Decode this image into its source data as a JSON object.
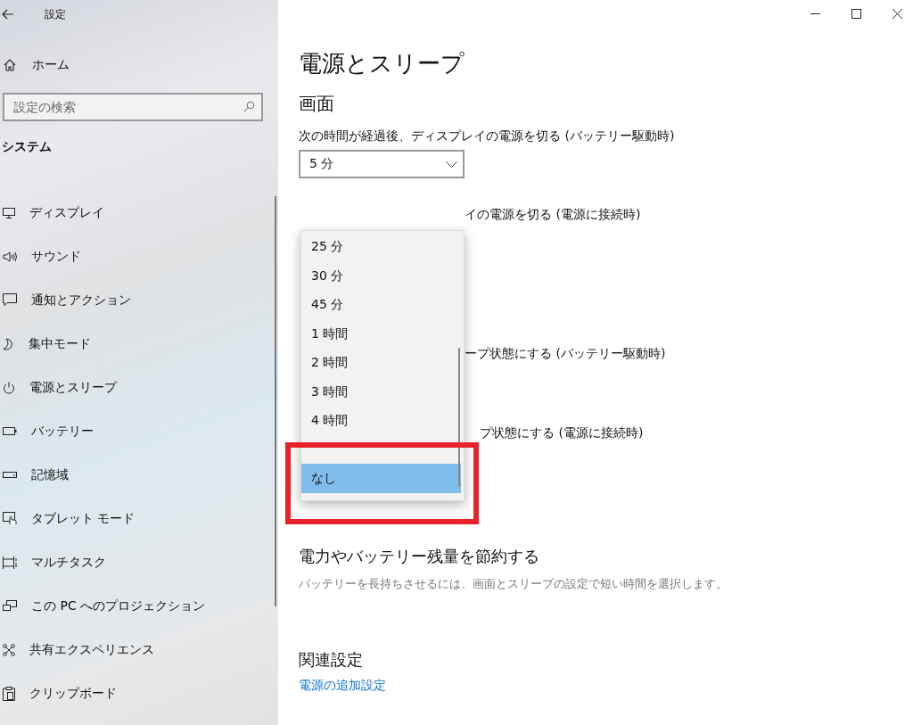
{
  "window": {
    "title": "設定"
  },
  "sidebar": {
    "home": "ホーム",
    "search": {
      "placeholder": "設定の検索"
    },
    "section": "システム",
    "items": [
      {
        "label": "ディスプレイ"
      },
      {
        "label": "サウンド"
      },
      {
        "label": "通知とアクション"
      },
      {
        "label": "集中モード"
      },
      {
        "label": "電源とスリープ"
      },
      {
        "label": "バッテリー"
      },
      {
        "label": "記憶域"
      },
      {
        "label": "タブレット モード"
      },
      {
        "label": "マルチタスク"
      },
      {
        "label": "この PC へのプロジェクション"
      },
      {
        "label": "共有エクスペリエンス"
      },
      {
        "label": "クリップボード"
      }
    ]
  },
  "main": {
    "title": "電源とスリープ",
    "section": "画面",
    "settings": [
      {
        "label": "次の時間が経過後、ディスプレイの電源を切る (バッテリー駆動時)",
        "value": "5 分"
      },
      {
        "label": "イの電源を切る (電源に接続時)"
      },
      {
        "label": "ープ状態にする (バッテリー駆動時)"
      },
      {
        "label": "プ状態にする (電源に接続時)"
      }
    ],
    "dropdown": {
      "options": [
        {
          "label": "25 分",
          "selected": false
        },
        {
          "label": "30 分",
          "selected": false
        },
        {
          "label": "45 分",
          "selected": false
        },
        {
          "label": "1 時間",
          "selected": false
        },
        {
          "label": "2 時間",
          "selected": false
        },
        {
          "label": "3 時間",
          "selected": false
        },
        {
          "label": "4 時間",
          "selected": false
        },
        {
          "label": "なし",
          "selected": true
        }
      ]
    },
    "save": {
      "title": "電力やバッテリー残量を節約する",
      "description": "バッテリーを長持ちさせるには、画面とスリープの設定で短い時間を選択します。"
    },
    "related": {
      "title": "関連設定",
      "link": "電源の追加設定"
    }
  }
}
